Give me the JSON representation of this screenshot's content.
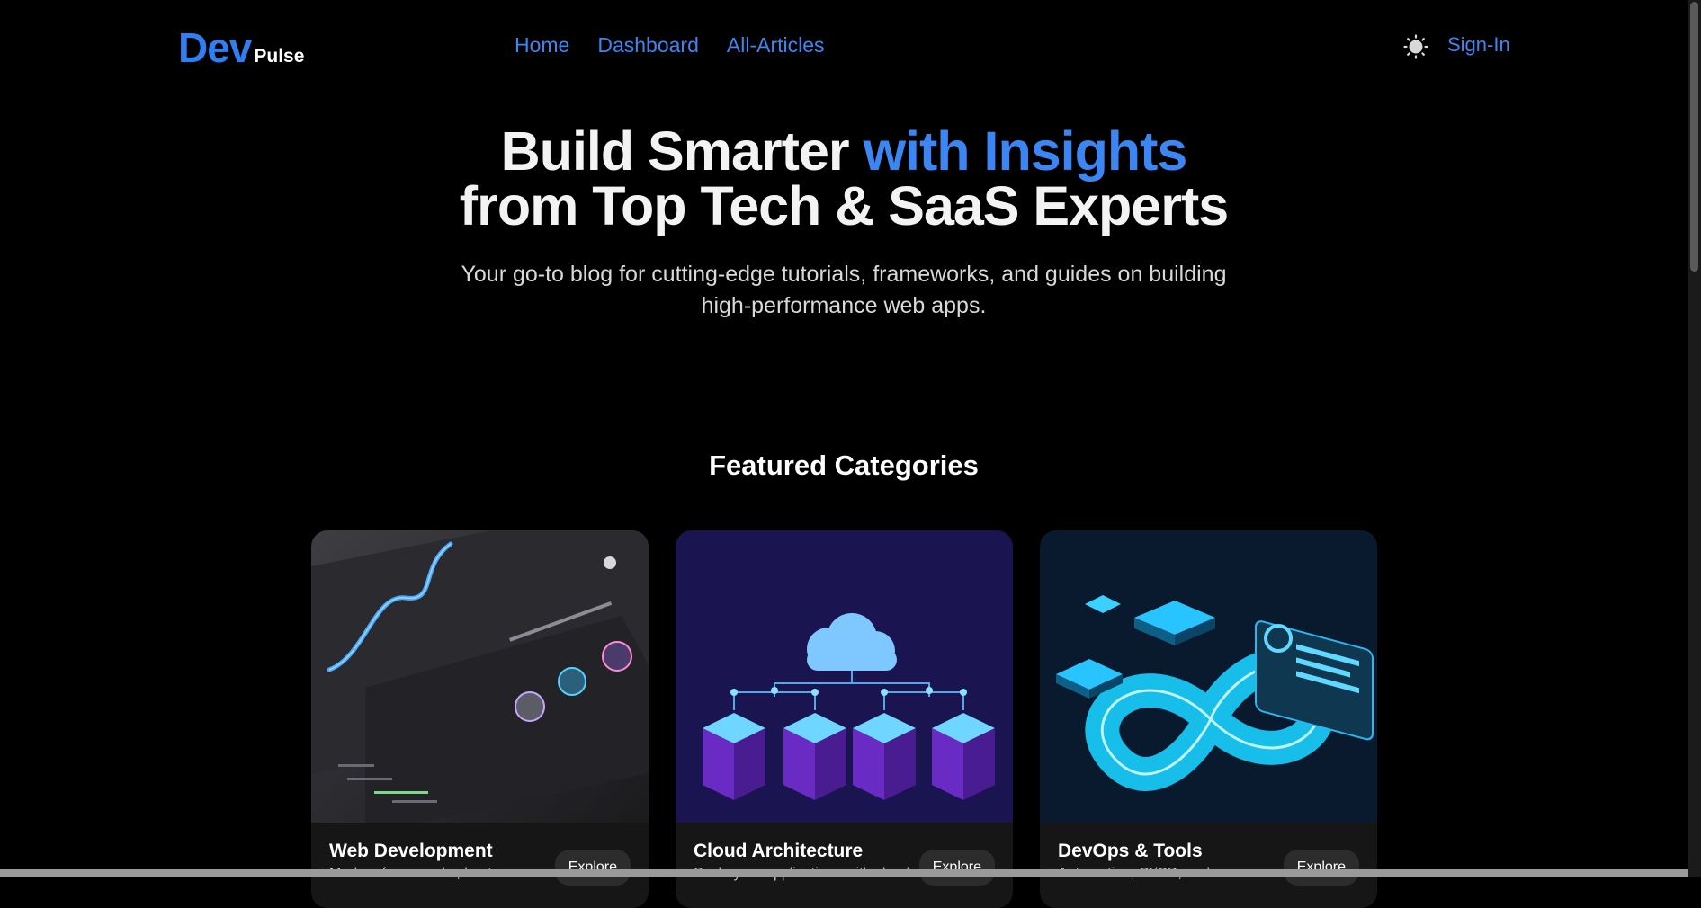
{
  "brand": {
    "dev": "Dev",
    "pulse": "Pulse"
  },
  "nav": {
    "links": [
      "Home",
      "Dashboard",
      "All-Articles"
    ],
    "sign_in": "Sign-In",
    "theme_icon": "sun-icon"
  },
  "hero": {
    "title_part1": "Build Smarter ",
    "title_accent": "with Insights",
    "title_line2": "from Top Tech & SaaS Experts",
    "subtitle": "Your go-to blog for cutting-edge tutorials, frameworks, and guides on building high-performance web apps."
  },
  "featured": {
    "heading": "Featured Categories",
    "cards": [
      {
        "title": "Web Development",
        "desc": "Modern frameworks, best",
        "button": "Explore"
      },
      {
        "title": "Cloud Architecture",
        "desc": "Scale your applications with cloud-",
        "button": "Explore"
      },
      {
        "title": "DevOps & Tools",
        "desc": "Automation, CI/CD, and",
        "button": "Explore"
      }
    ]
  },
  "colors": {
    "accent": "#3b86f2",
    "background": "#000000"
  }
}
